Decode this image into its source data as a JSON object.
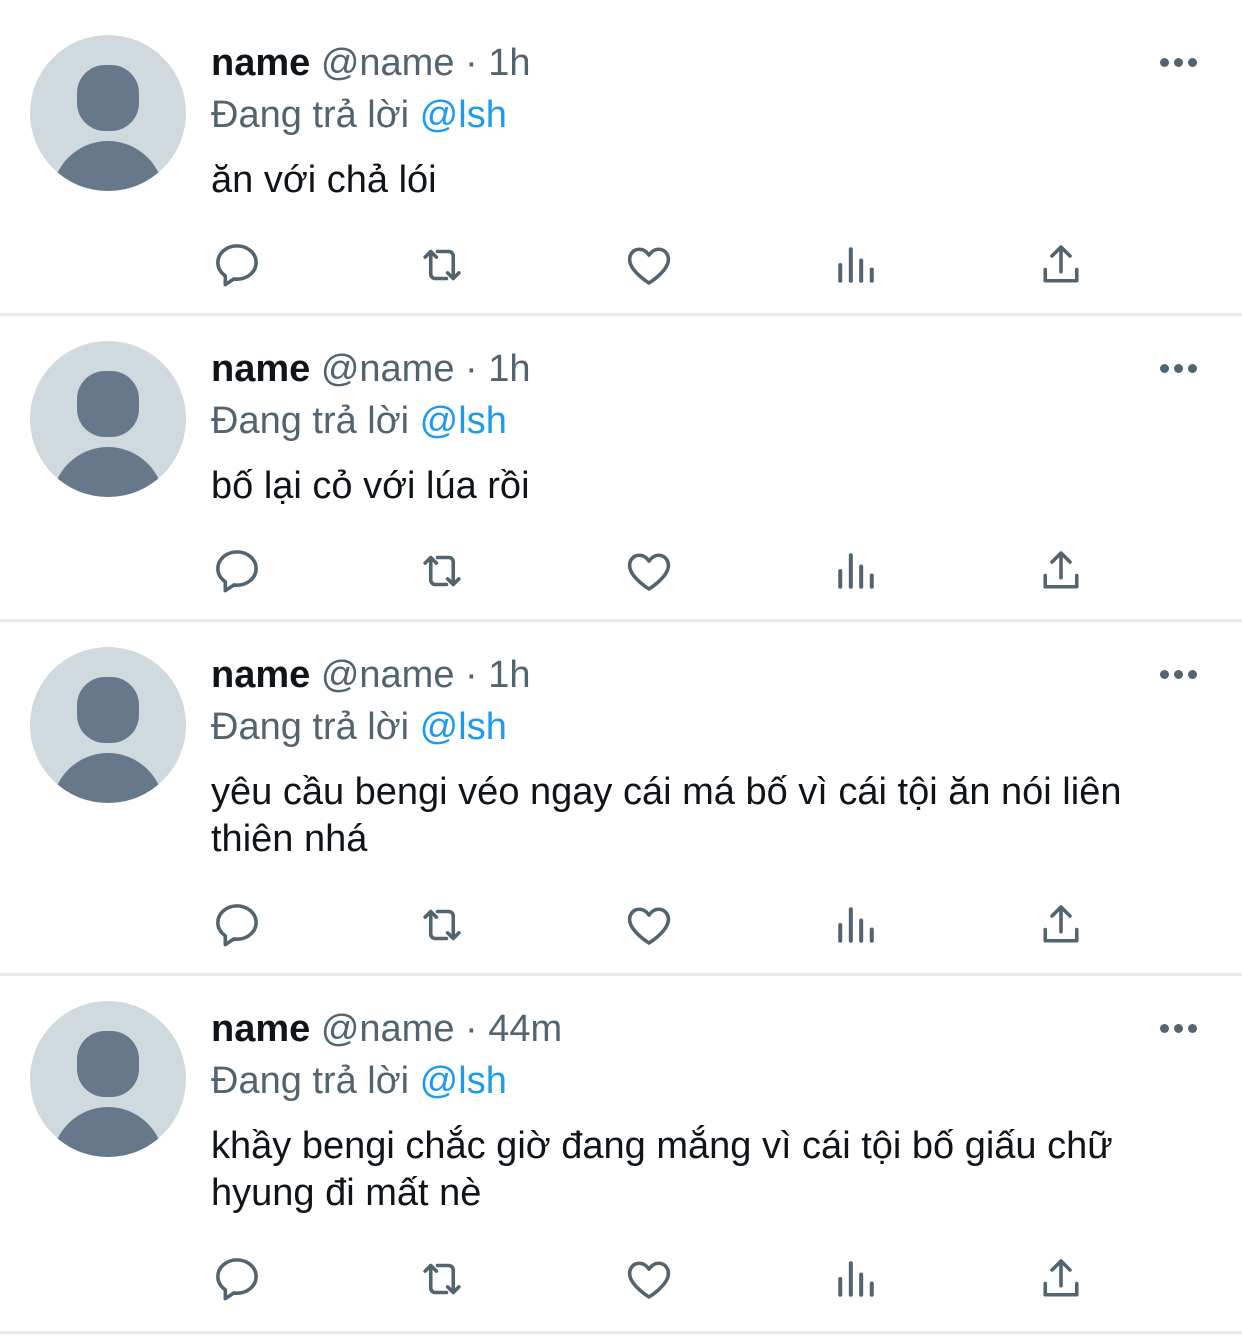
{
  "tweets": [
    {
      "name": "name",
      "handle": "@name",
      "separator": "·",
      "time": "1h",
      "reply_prefix": "Đang trả lời",
      "reply_to": "@lsh",
      "text": "ăn với chả lói"
    },
    {
      "name": "name",
      "handle": "@name",
      "separator": "·",
      "time": "1h",
      "reply_prefix": "Đang trả lời",
      "reply_to": "@lsh",
      "text": "bố lại cỏ với lúa rồi"
    },
    {
      "name": "name",
      "handle": "@name",
      "separator": "·",
      "time": "1h",
      "reply_prefix": "Đang trả lời",
      "reply_to": "@lsh",
      "text": "yêu cầu bengi véo ngay cái má bố vì cái tội ăn nói liên thiên nhá"
    },
    {
      "name": "name",
      "handle": "@name",
      "separator": "·",
      "time": "44m",
      "reply_prefix": "Đang trả lời",
      "reply_to": "@lsh",
      "text": "khầy bengi chắc giờ đang mắng vì cái tội bố giấu chữ hyung đi mất nè"
    }
  ],
  "colors": {
    "text_primary": "#0f1419",
    "text_secondary": "#536471",
    "accent": "#1d9bf0",
    "avatar_bg": "#cfd9de",
    "avatar_fg": "#66788a",
    "divider": "#e7e9eb"
  },
  "action_icons": [
    "reply-icon",
    "retweet-icon",
    "like-icon",
    "views-icon",
    "share-icon"
  ],
  "menu_icon": "more-icon"
}
